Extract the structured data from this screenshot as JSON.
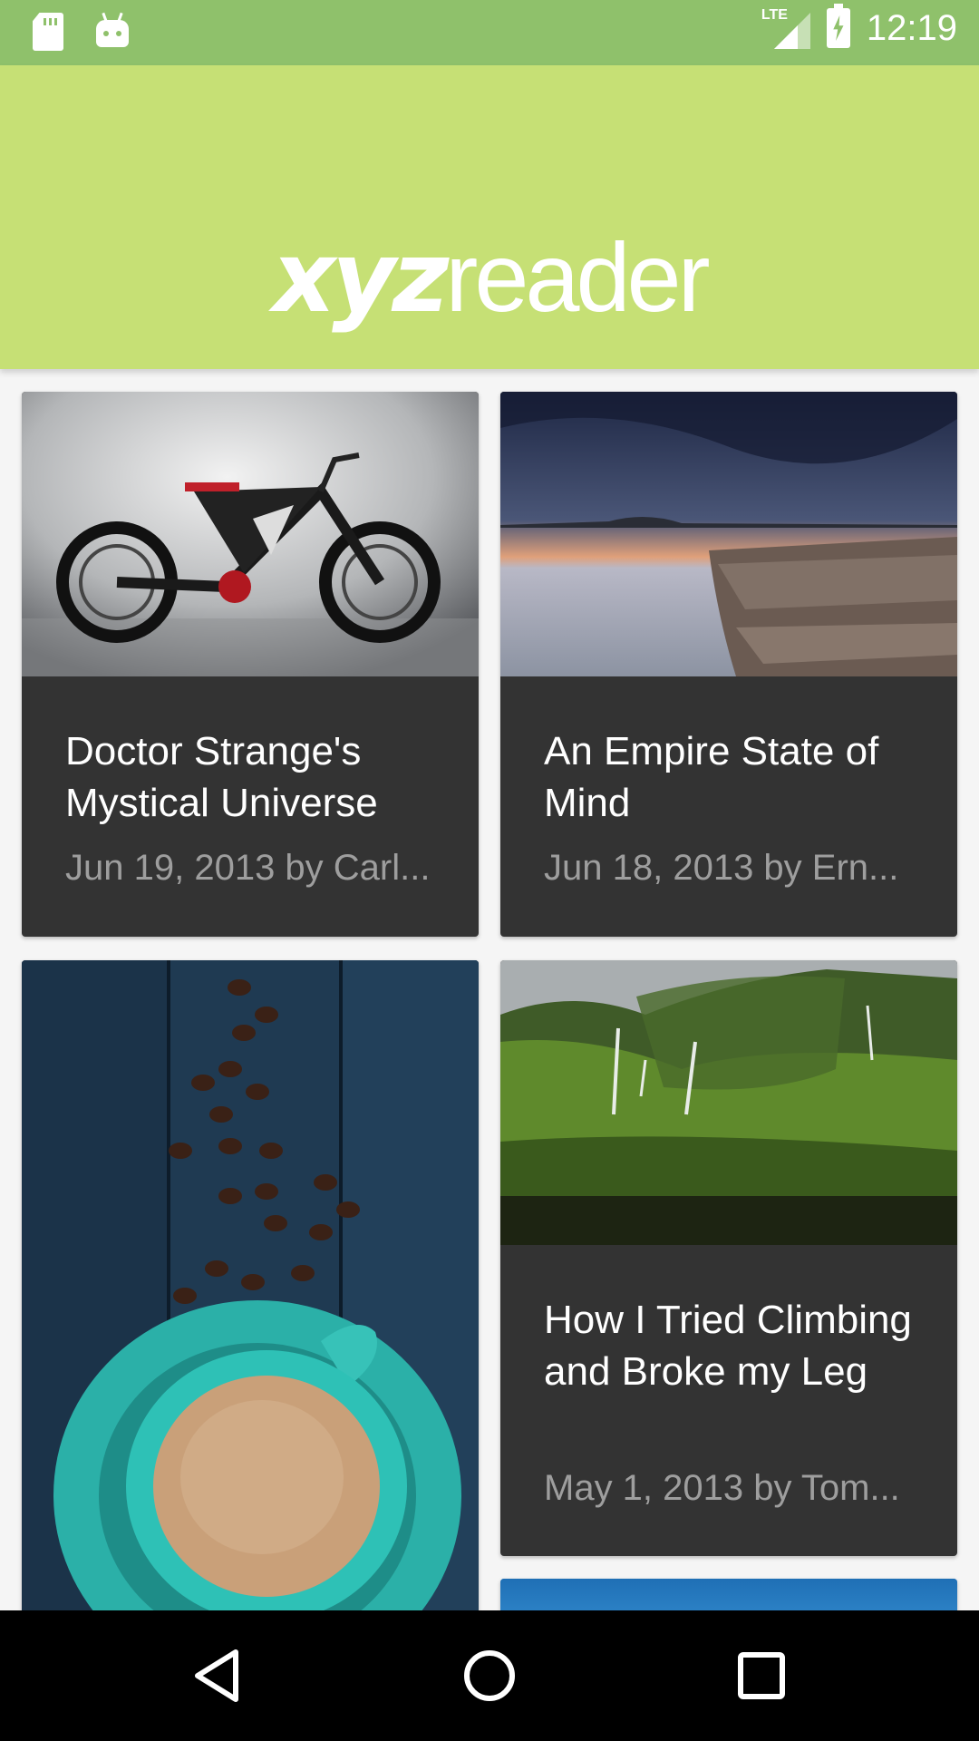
{
  "status_bar": {
    "network": "LTE",
    "time": "12:19",
    "icons": [
      "sd-card-icon",
      "android-icon",
      "signal-icon",
      "battery-charging-icon"
    ]
  },
  "app_bar": {
    "logo_bold": "xyz",
    "logo_light": "reader",
    "color": "#c6e075"
  },
  "articles": [
    {
      "title": "Doctor Strange's Mystical Universe",
      "meta": "Jun 19, 2013 by Carl...",
      "image": "bicycle"
    },
    {
      "title": "An Empire State of Mind",
      "meta": "Jun 18, 2013 by Ern...",
      "image": "seascape"
    },
    {
      "title": "",
      "meta": "",
      "image": "coffee"
    },
    {
      "title": "How I Tried Climbing and Broke my Leg",
      "meta": "May 1, 2013 by Tom...",
      "image": "waterfalls"
    }
  ],
  "nav_bar": {
    "icons": [
      "back-icon",
      "home-icon",
      "recents-icon"
    ]
  },
  "colors": {
    "status_bar": "#8fc16b",
    "card_bg": "#333333",
    "meta_text": "#9e9e9e"
  }
}
